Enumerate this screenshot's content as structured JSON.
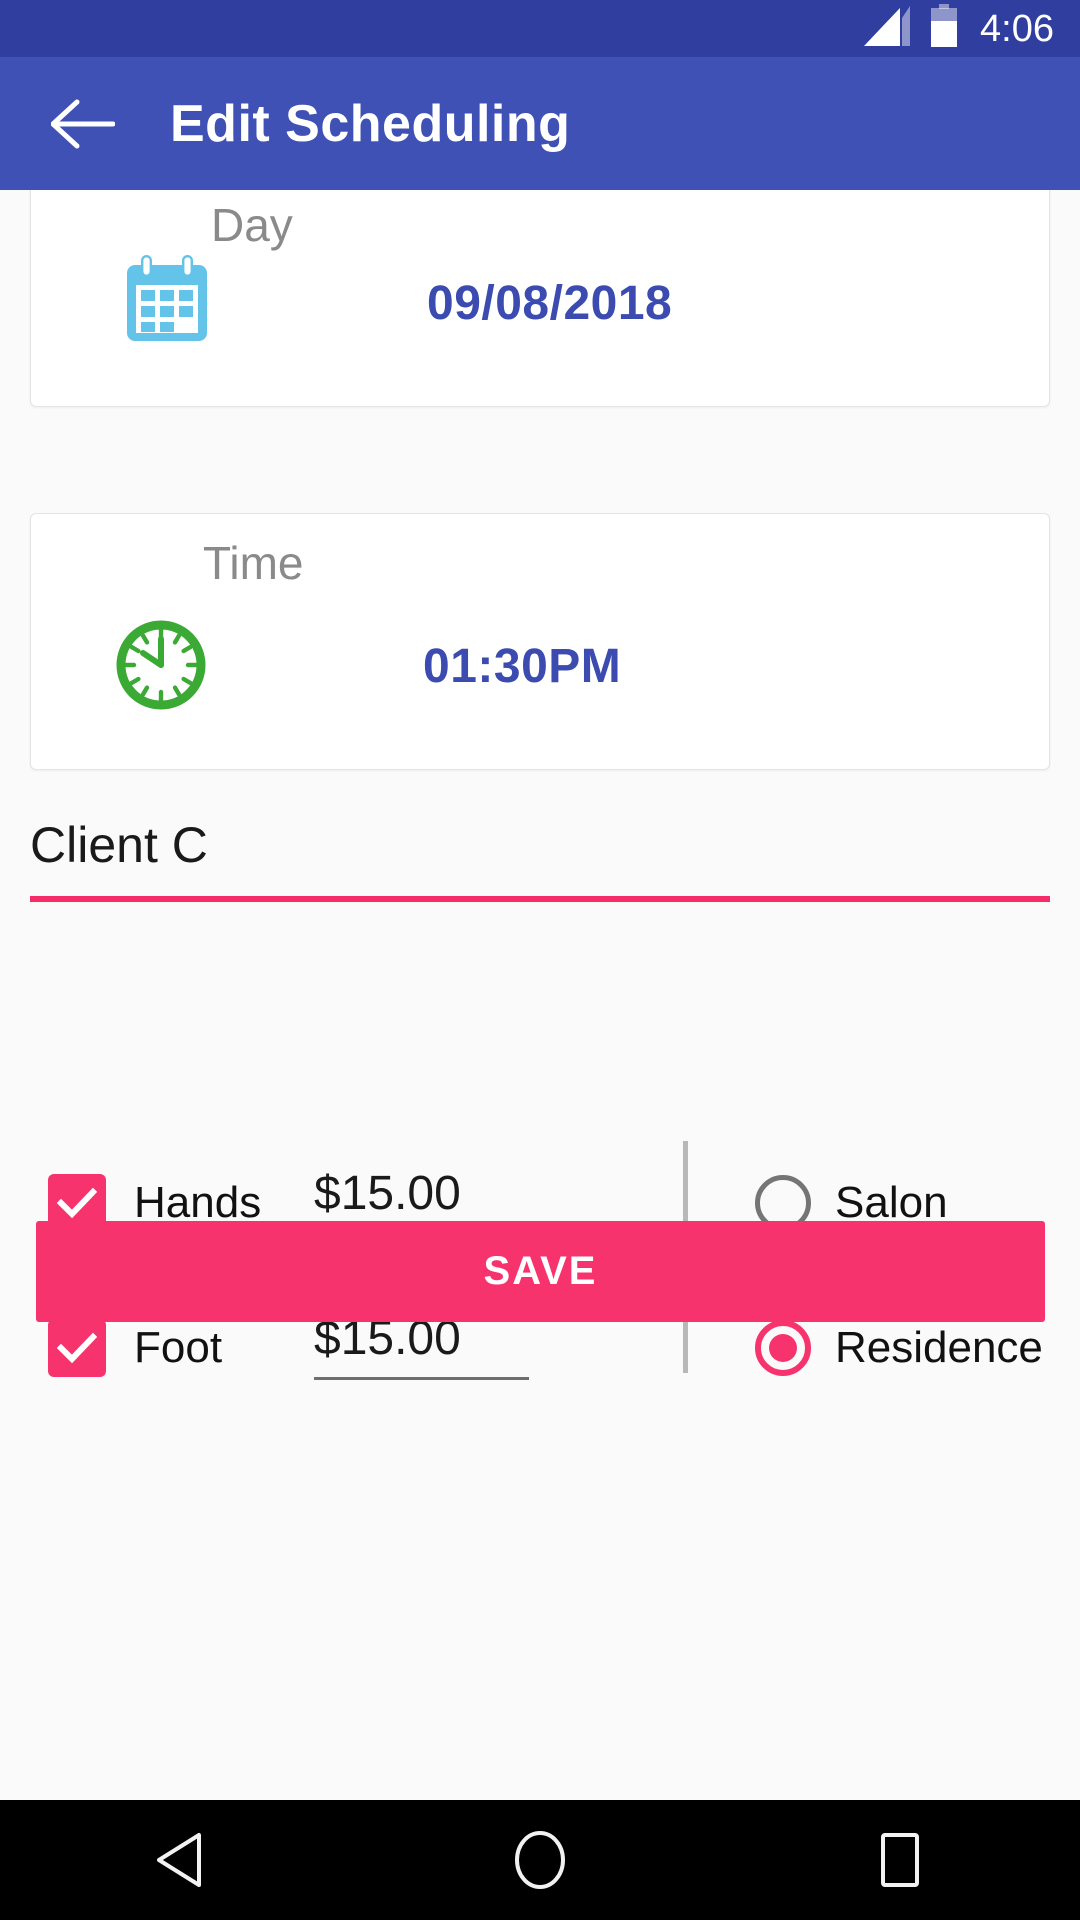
{
  "status_bar": {
    "time": "4:06",
    "signal_icon": "signal-bars-icon",
    "battery_icon": "battery-icon",
    "background_color": "#303F9F"
  },
  "app_bar": {
    "title": "Edit Scheduling",
    "back_icon": "back-arrow-icon",
    "background_color": "#3F51B5"
  },
  "day_card": {
    "label": "Day",
    "value": "09/08/2018",
    "icon": "calendar-icon",
    "icon_color": "#64C3E8",
    "value_color": "#3B4BAF"
  },
  "time_card": {
    "label": "Time",
    "value": "01:30PM",
    "icon": "clock-icon",
    "icon_color": "#3AAA35",
    "value_color": "#3B4BAF"
  },
  "client_field": {
    "value": "Client C",
    "placeholder": "Client Name",
    "underline_color": "#F42D6A"
  },
  "services": [
    {
      "label": "Hands",
      "checked": true,
      "price": "$15.00"
    },
    {
      "label": "Foot",
      "checked": true,
      "price": "$15.00"
    }
  ],
  "location_options": [
    {
      "label": "Salon",
      "selected": false
    },
    {
      "label": "Residence",
      "selected": true
    }
  ],
  "save_button": {
    "label": "SAVE",
    "color": "#F7336E"
  },
  "nav_bar": {
    "back": "triangle-back-icon",
    "home": "circle-home-icon",
    "recents": "square-recents-icon"
  }
}
